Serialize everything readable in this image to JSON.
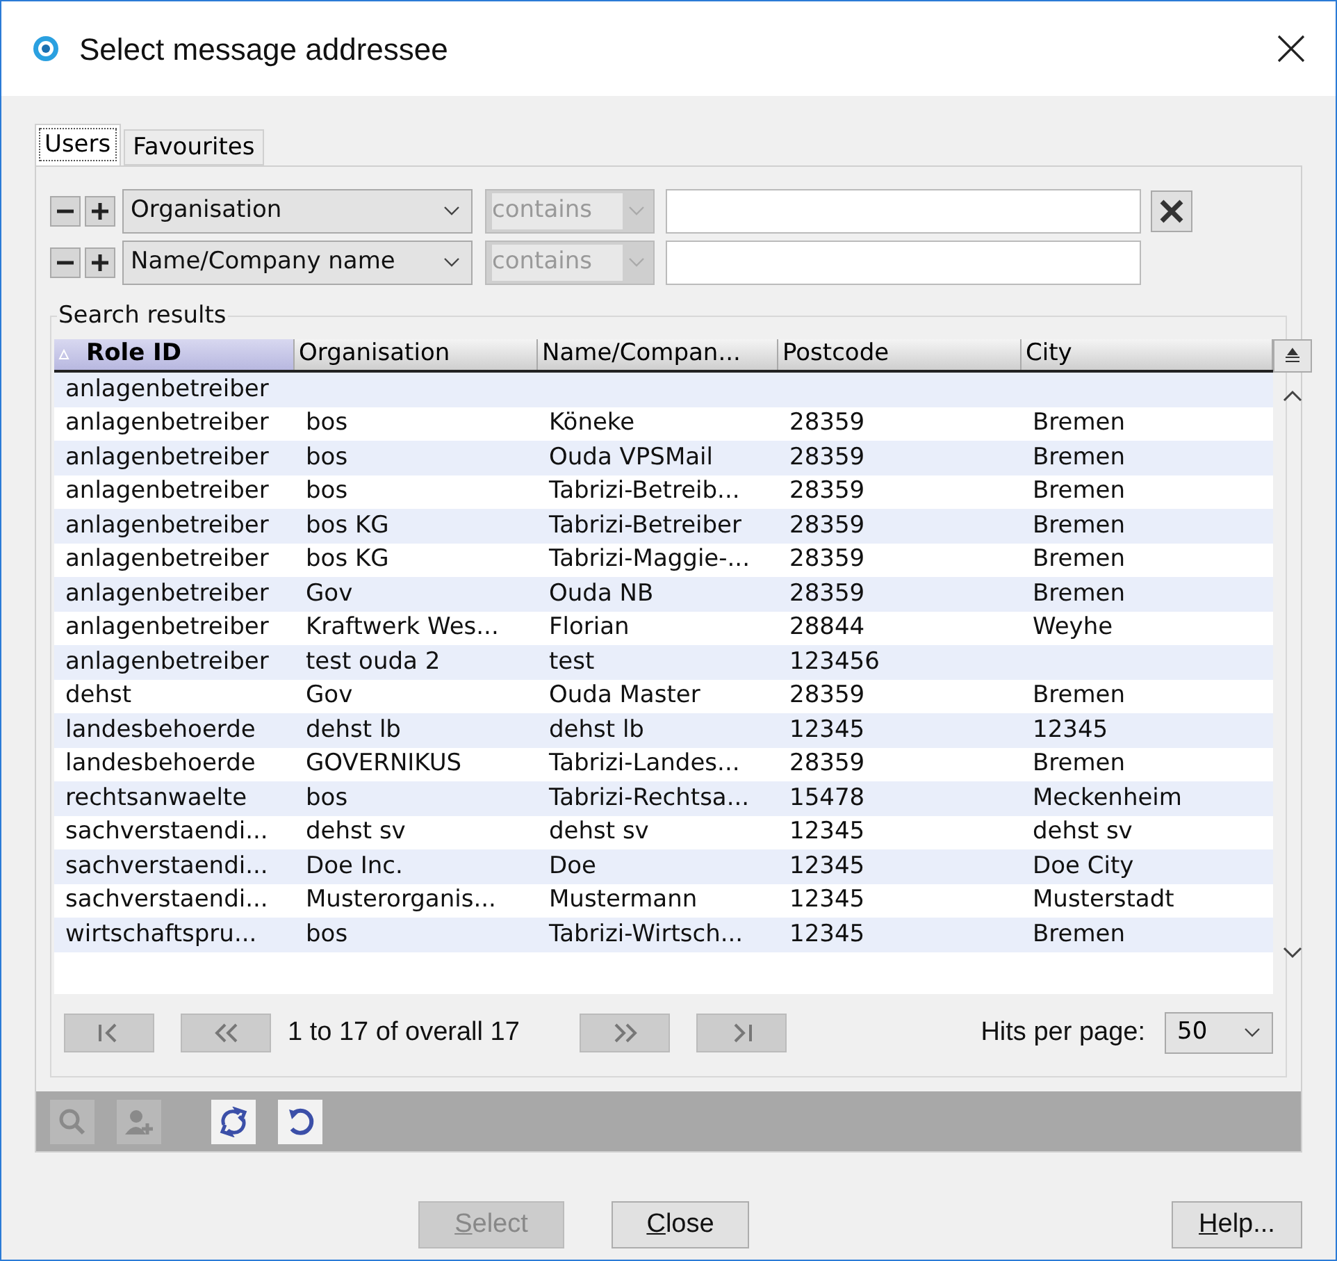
{
  "window": {
    "title": "Select message addressee"
  },
  "tabs": [
    {
      "label": "Users",
      "selected": true
    },
    {
      "label": "Favourites",
      "selected": false
    }
  ],
  "filters": [
    {
      "field": "Organisation",
      "operator": "contains",
      "operator_disabled": true,
      "clear_button": true
    },
    {
      "field": "Name/Company name",
      "operator": "contains",
      "operator_disabled": true,
      "clear_button": false
    }
  ],
  "results": {
    "title": "Search results",
    "columns": [
      {
        "label": "Role ID",
        "sorted": true
      },
      {
        "label": "Organisation",
        "sorted": false
      },
      {
        "label": "Name/Compan...",
        "sorted": false
      },
      {
        "label": "Postcode",
        "sorted": false
      },
      {
        "label": "City",
        "sorted": false
      }
    ],
    "rows": [
      {
        "cells": [
          "anlagenbetreiber"
        ]
      },
      {
        "cells": [
          "anlagenbetreiber",
          "bos",
          "Köneke",
          "28359",
          "Bremen"
        ]
      },
      {
        "cells": [
          "anlagenbetreiber",
          "bos",
          "Ouda VPSMail",
          "28359",
          "Bremen"
        ]
      },
      {
        "cells": [
          "anlagenbetreiber",
          "bos",
          "Tabrizi-Betreib...",
          "28359",
          "Bremen"
        ]
      },
      {
        "cells": [
          "anlagenbetreiber",
          "bos KG",
          "Tabrizi-Betreiber",
          "28359",
          "Bremen"
        ]
      },
      {
        "cells": [
          "anlagenbetreiber",
          "bos KG",
          "Tabrizi-Maggie-...",
          "28359",
          "Bremen"
        ]
      },
      {
        "cells": [
          "anlagenbetreiber",
          "Gov",
          "Ouda NB",
          "28359",
          "Bremen"
        ]
      },
      {
        "cells": [
          "anlagenbetreiber",
          "Kraftwerk Wes...",
          "Florian",
          "28844",
          "Weyhe"
        ]
      },
      {
        "cells": [
          "anlagenbetreiber",
          "test ouda 2",
          "test",
          "123456"
        ]
      },
      {
        "cells": [
          "dehst",
          "Gov",
          "Ouda Master",
          "28359",
          "Bremen"
        ]
      },
      {
        "cells": [
          "landesbehoerde",
          "dehst lb",
          "dehst lb",
          "12345",
          "12345"
        ]
      },
      {
        "cells": [
          "landesbehoerde",
          "GOVERNIKUS",
          "Tabrizi-Landes...",
          "28359",
          "Bremen"
        ]
      },
      {
        "cells": [
          "rechtsanwaelte",
          "bos",
          "Tabrizi-Rechtsa...",
          "15478",
          "Meckenheim"
        ]
      },
      {
        "cells": [
          "sachverstaendi...",
          "dehst sv",
          "dehst sv",
          "12345",
          "dehst sv"
        ]
      },
      {
        "cells": [
          "sachverstaendi...",
          "Doe Inc.",
          "Doe",
          "12345",
          "Doe City"
        ]
      },
      {
        "cells": [
          "sachverstaendi...",
          "Musterorganis...",
          "Mustermann",
          "12345",
          "Musterstadt"
        ]
      },
      {
        "cells": [
          "wirtschaftspru...",
          "bos",
          "Tabrizi-Wirtsch...",
          "12345",
          "Bremen"
        ]
      }
    ],
    "pager": {
      "summary": "1 to 17 of overall 17",
      "hits_label": "Hits per page:",
      "hits_value": "50"
    }
  },
  "toolbar": [
    {
      "kind": "search-user",
      "disabled": true
    },
    {
      "kind": "add-user",
      "disabled": true
    },
    {
      "kind": "refresh",
      "disabled": false
    },
    {
      "kind": "reset",
      "disabled": false
    }
  ],
  "buttons": [
    {
      "label": "Select",
      "disabled": true,
      "underline_first": true
    },
    {
      "label": "Close",
      "disabled": false,
      "underline_first": true
    },
    {
      "label": "Help...",
      "disabled": false,
      "underline_first": true
    }
  ]
}
